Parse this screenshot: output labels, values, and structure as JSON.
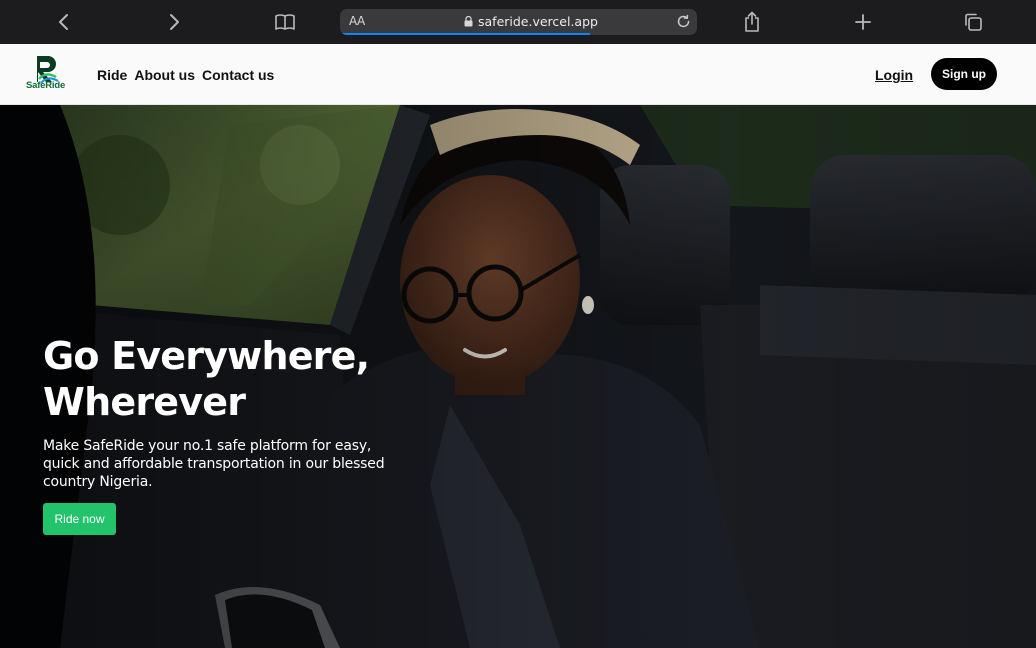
{
  "browser": {
    "text_size_label": "AA",
    "url": "saferide.vercel.app",
    "icons": [
      "back-icon",
      "forward-icon",
      "book-icon",
      "lock-icon",
      "reload-icon",
      "share-icon",
      "plus-icon",
      "tabs-icon"
    ]
  },
  "header": {
    "logo_text": "SafeRide",
    "nav": [
      "Ride",
      "About us",
      "Contact us"
    ],
    "login_label": "Login",
    "signup_label": "Sign up"
  },
  "hero": {
    "title_line1": "Go Everywhere,",
    "title_line2": "Wherever",
    "subtitle": "Make SafeRide your no.1 safe platform for easy, quick and affordable transportation in our blessed country Nigeria.",
    "cta_label": "Ride now"
  },
  "colors": {
    "accent_green": "#22c36a",
    "brand_dark_green": "#0f6b3a",
    "signup_bg": "#000000",
    "chrome_bg": "#1c1c1e"
  }
}
